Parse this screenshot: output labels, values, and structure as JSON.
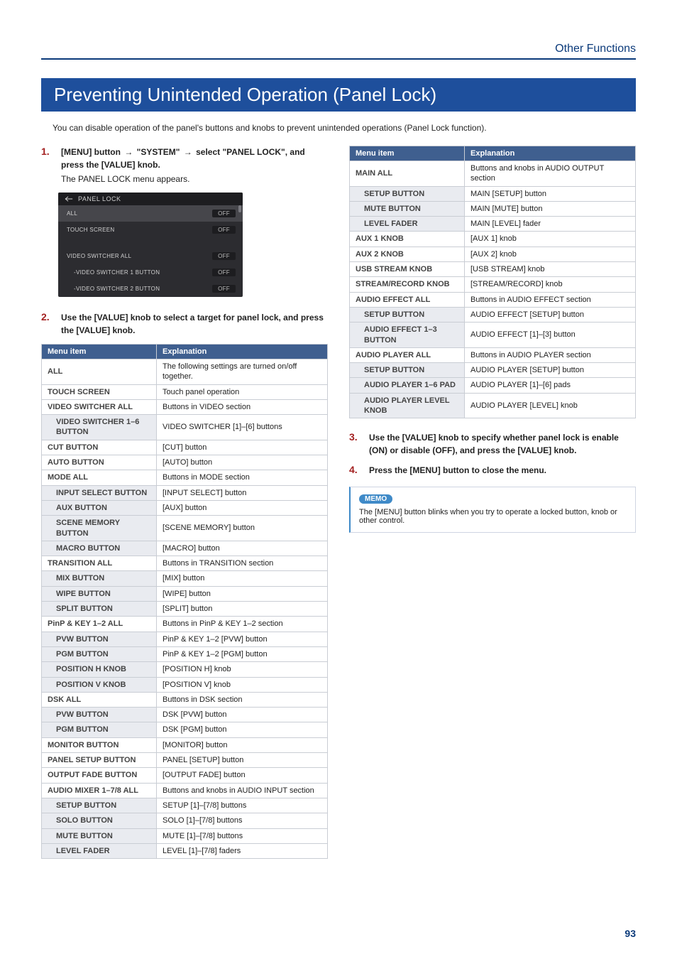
{
  "header": {
    "breadcrumb": "Other Functions",
    "title": "Preventing Unintended Operation (Panel Lock)",
    "intro": "You can disable operation of the panel's buttons and knobs to prevent unintended operations (Panel Lock function)."
  },
  "steps": {
    "s1": {
      "num": "1.",
      "parts": {
        "a": "[MENU] button",
        "b": "\"SYSTEM\"",
        "c": "select \"PANEL LOCK\", and press the [VALUE] knob."
      },
      "after": "The PANEL LOCK menu appears."
    },
    "s2": {
      "num": "2.",
      "main": "Use the [VALUE] knob to select a target for panel lock, and press the [VALUE] knob."
    },
    "s3": {
      "num": "3.",
      "main": "Use the [VALUE] knob to specify whether panel lock is enable (ON) or disable (OFF), and press the [VALUE] knob."
    },
    "s4": {
      "num": "4.",
      "main": "Press the [MENU] button to close the menu."
    }
  },
  "panel": {
    "title": "PANEL LOCK",
    "off": "OFF",
    "rows": {
      "all": "ALL",
      "touch": "TOUCH SCREEN",
      "vs_all": "VIDEO SWITCHER ALL",
      "vs1": "-VIDEO SWITCHER 1 BUTTON",
      "vs2": "-VIDEO SWITCHER 2 BUTTON"
    }
  },
  "tableA": {
    "head1": "Menu item",
    "head2": "Explanation",
    "rows": [
      {
        "indent": 0,
        "k": "ALL",
        "v": "The following settings are turned on/off together."
      },
      {
        "indent": 0,
        "k": "TOUCH SCREEN",
        "v": "Touch panel operation"
      },
      {
        "indent": 0,
        "k": "VIDEO SWITCHER ALL",
        "v": "Buttons in VIDEO section"
      },
      {
        "indent": 1,
        "k": "VIDEO SWITCHER 1–6 BUTTON",
        "v": "VIDEO SWITCHER [1]–[6] buttons"
      },
      {
        "indent": 0,
        "k": "CUT BUTTON",
        "v": "[CUT] button"
      },
      {
        "indent": 0,
        "k": "AUTO BUTTON",
        "v": "[AUTO] button"
      },
      {
        "indent": 0,
        "k": "MODE ALL",
        "v": "Buttons in MODE section"
      },
      {
        "indent": 1,
        "k": "INPUT SELECT BUTTON",
        "v": "[INPUT SELECT] button"
      },
      {
        "indent": 1,
        "k": "AUX BUTTON",
        "v": "[AUX] button"
      },
      {
        "indent": 1,
        "k": "SCENE MEMORY BUTTON",
        "v": "[SCENE MEMORY] button"
      },
      {
        "indent": 1,
        "k": "MACRO BUTTON",
        "v": "[MACRO] button"
      },
      {
        "indent": 0,
        "k": "TRANSITION ALL",
        "v": "Buttons in TRANSITION section"
      },
      {
        "indent": 1,
        "k": "MIX BUTTON",
        "v": "[MIX] button"
      },
      {
        "indent": 1,
        "k": "WIPE BUTTON",
        "v": "[WIPE] button"
      },
      {
        "indent": 1,
        "k": "SPLIT BUTTON",
        "v": "[SPLIT] button"
      },
      {
        "indent": 0,
        "k": "PinP & KEY 1–2 ALL",
        "v": "Buttons in PinP & KEY 1–2 section"
      },
      {
        "indent": 1,
        "k": "PVW BUTTON",
        "v": "PinP & KEY 1–2 [PVW] button"
      },
      {
        "indent": 1,
        "k": "PGM BUTTON",
        "v": "PinP & KEY 1–2 [PGM] button"
      },
      {
        "indent": 1,
        "k": "POSITION H KNOB",
        "v": "[POSITION H] knob"
      },
      {
        "indent": 1,
        "k": "POSITION V KNOB",
        "v": "[POSITION V] knob"
      },
      {
        "indent": 0,
        "k": "DSK ALL",
        "v": "Buttons in DSK section"
      },
      {
        "indent": 1,
        "k": "PVW BUTTON",
        "v": "DSK [PVW] button"
      },
      {
        "indent": 1,
        "k": "PGM BUTTON",
        "v": "DSK [PGM] button"
      },
      {
        "indent": 0,
        "k": "MONITOR BUTTON",
        "v": "[MONITOR] button"
      },
      {
        "indent": 0,
        "k": "PANEL SETUP BUTTON",
        "v": "PANEL [SETUP] button"
      },
      {
        "indent": 0,
        "k": "OUTPUT FADE BUTTON",
        "v": "[OUTPUT FADE] button"
      },
      {
        "indent": 0,
        "k": "AUDIO MIXER 1–7/8 ALL",
        "v": "Buttons and knobs in AUDIO INPUT section"
      },
      {
        "indent": 1,
        "k": "SETUP BUTTON",
        "v": "SETUP [1]–[7/8] buttons"
      },
      {
        "indent": 1,
        "k": "SOLO BUTTON",
        "v": "SOLO [1]–[7/8] buttons"
      },
      {
        "indent": 1,
        "k": "MUTE BUTTON",
        "v": "MUTE [1]–[7/8] buttons"
      },
      {
        "indent": 1,
        "k": "LEVEL FADER",
        "v": "LEVEL [1]–[7/8] faders"
      }
    ]
  },
  "tableB": {
    "head1": "Menu item",
    "head2": "Explanation",
    "rows": [
      {
        "indent": 0,
        "k": "MAIN ALL",
        "v": "Buttons and knobs in AUDIO OUTPUT section"
      },
      {
        "indent": 1,
        "k": "SETUP BUTTON",
        "v": "MAIN [SETUP] button"
      },
      {
        "indent": 1,
        "k": "MUTE BUTTON",
        "v": "MAIN [MUTE] button"
      },
      {
        "indent": 1,
        "k": "LEVEL FADER",
        "v": "MAIN [LEVEL] fader"
      },
      {
        "indent": 0,
        "k": "AUX 1 KNOB",
        "v": "[AUX 1] knob"
      },
      {
        "indent": 0,
        "k": "AUX 2 KNOB",
        "v": "[AUX 2] knob"
      },
      {
        "indent": 0,
        "k": "USB STREAM KNOB",
        "v": "[USB STREAM] knob"
      },
      {
        "indent": 0,
        "k": "STREAM/RECORD KNOB",
        "v": "[STREAM/RECORD] knob"
      },
      {
        "indent": 0,
        "k": "AUDIO EFFECT ALL",
        "v": "Buttons in AUDIO EFFECT section"
      },
      {
        "indent": 1,
        "k": "SETUP BUTTON",
        "v": "AUDIO EFFECT [SETUP] button"
      },
      {
        "indent": 1,
        "k": "AUDIO EFFECT 1–3 BUTTON",
        "v": "AUDIO EFFECT [1]–[3] button"
      },
      {
        "indent": 0,
        "k": "AUDIO PLAYER ALL",
        "v": "Buttons in AUDIO PLAYER section"
      },
      {
        "indent": 1,
        "k": "SETUP BUTTON",
        "v": "AUDIO PLAYER [SETUP] button"
      },
      {
        "indent": 1,
        "k": "AUDIO PLAYER 1–6 PAD",
        "v": "AUDIO PLAYER [1]–[6] pads"
      },
      {
        "indent": 1,
        "k": "AUDIO PLAYER LEVEL KNOB",
        "v": "AUDIO PLAYER [LEVEL] knob"
      }
    ]
  },
  "memo": {
    "label": "MEMO",
    "text": "The [MENU] button blinks when you try to operate a locked button, knob or other control."
  },
  "page_number": "93"
}
